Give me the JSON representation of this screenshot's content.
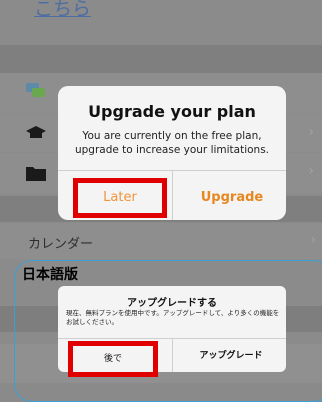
{
  "english_screen": {
    "top_link": "こちら",
    "calendar_label": "カレンダー",
    "dialog": {
      "title": "Upgrade your plan",
      "message": "You are currently on the free plan, upgrade to increase your limitations.",
      "later_button": "Later",
      "upgrade_button": "Upgrade"
    }
  },
  "japanese_screen": {
    "heading": "日本語版",
    "dialog": {
      "title": "アップグレードする",
      "message": "現在、無料プランを使用中です。アップグレードして、より多くの機能をお試しください。",
      "later_button": "後で",
      "upgrade_button": "アップグレード"
    }
  },
  "colors": {
    "highlight": "#e00000",
    "accent_orange": "#e8871f",
    "frame_blue": "#3aa0d8"
  },
  "icons": [
    "chat-icon",
    "graduation-cap-icon",
    "folder-icon",
    "chevron-right-icon"
  ]
}
